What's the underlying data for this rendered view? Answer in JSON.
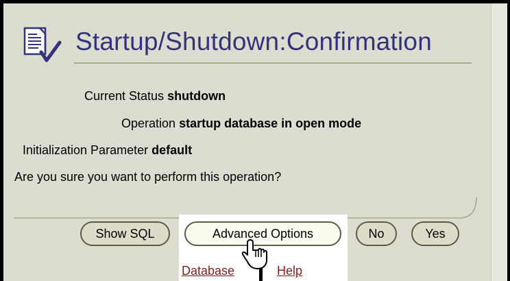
{
  "title": "Startup/Shutdown:Confirmation",
  "fields": [
    {
      "label": "Current Status",
      "value": "shutdown"
    },
    {
      "label": "Operation",
      "value": "startup database in open mode"
    },
    {
      "label": "Initialization Parameter",
      "value": "default"
    }
  ],
  "prompt": "Are you sure you want to perform this operation?",
  "buttons": {
    "show_sql": "Show SQL",
    "advanced": "Advanced Options",
    "no": "No",
    "yes": "Yes"
  },
  "footer": {
    "database": "Database",
    "help": "Help"
  },
  "colors": {
    "title": "#33337a",
    "panel": "#dcdcd0",
    "link": "#7a1f1f"
  },
  "icons": [
    "document-check-icon",
    "hand-pointer-cursor-icon"
  ]
}
